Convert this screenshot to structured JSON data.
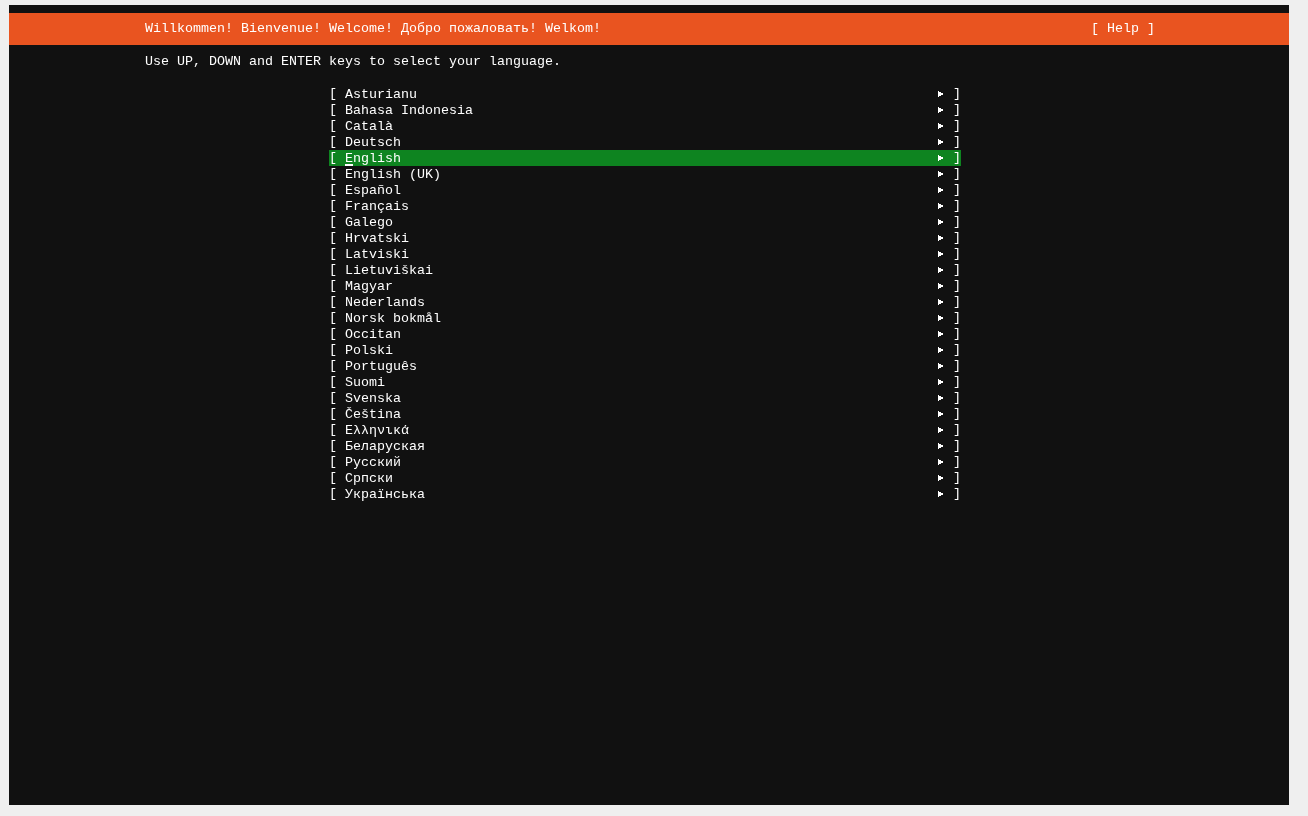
{
  "header": {
    "title": "Willkommen! Bienvenue! Welcome! Добро пожаловать! Welkom!",
    "help": "[ Help ]"
  },
  "instructions": "Use UP, DOWN and ENTER keys to select your language.",
  "languages": [
    {
      "open": "[",
      "label": "Asturianu",
      "close": "]",
      "selected": false
    },
    {
      "open": "[",
      "label": "Bahasa Indonesia",
      "close": "]",
      "selected": false
    },
    {
      "open": "[",
      "label": "Català",
      "close": "]",
      "selected": false
    },
    {
      "open": "[",
      "label": "Deutsch",
      "close": "]",
      "selected": false
    },
    {
      "open": "[",
      "label": "English",
      "close": "]",
      "selected": true
    },
    {
      "open": "[",
      "label": "English (UK)",
      "close": "]",
      "selected": false
    },
    {
      "open": "[",
      "label": "Español",
      "close": "]",
      "selected": false
    },
    {
      "open": "[",
      "label": "Français",
      "close": "]",
      "selected": false
    },
    {
      "open": "[",
      "label": "Galego",
      "close": "]",
      "selected": false
    },
    {
      "open": "[",
      "label": "Hrvatski",
      "close": "]",
      "selected": false
    },
    {
      "open": "[",
      "label": "Latviski",
      "close": "]",
      "selected": false
    },
    {
      "open": "[",
      "label": "Lietuviškai",
      "close": "]",
      "selected": false
    },
    {
      "open": "[",
      "label": "Magyar",
      "close": "]",
      "selected": false
    },
    {
      "open": "[",
      "label": "Nederlands",
      "close": "]",
      "selected": false
    },
    {
      "open": "[",
      "label": "Norsk bokmål",
      "close": "]",
      "selected": false
    },
    {
      "open": "[",
      "label": "Occitan",
      "close": "]",
      "selected": false
    },
    {
      "open": "[",
      "label": "Polski",
      "close": "]",
      "selected": false
    },
    {
      "open": "[",
      "label": "Português",
      "close": "]",
      "selected": false
    },
    {
      "open": "[",
      "label": "Suomi",
      "close": "]",
      "selected": false
    },
    {
      "open": "[",
      "label": "Svenska",
      "close": "]",
      "selected": false
    },
    {
      "open": "[",
      "label": "Čeština",
      "close": "]",
      "selected": false
    },
    {
      "open": "[",
      "label": "Ελληνικά",
      "close": "]",
      "selected": false
    },
    {
      "open": "[",
      "label": "Беларуская",
      "close": "]",
      "selected": false
    },
    {
      "open": "[",
      "label": "Русский",
      "close": "]",
      "selected": false
    },
    {
      "open": "[",
      "label": "Српски",
      "close": "]",
      "selected": false
    },
    {
      "open": "[",
      "label": "Українська",
      "close": "]",
      "selected": false
    }
  ]
}
